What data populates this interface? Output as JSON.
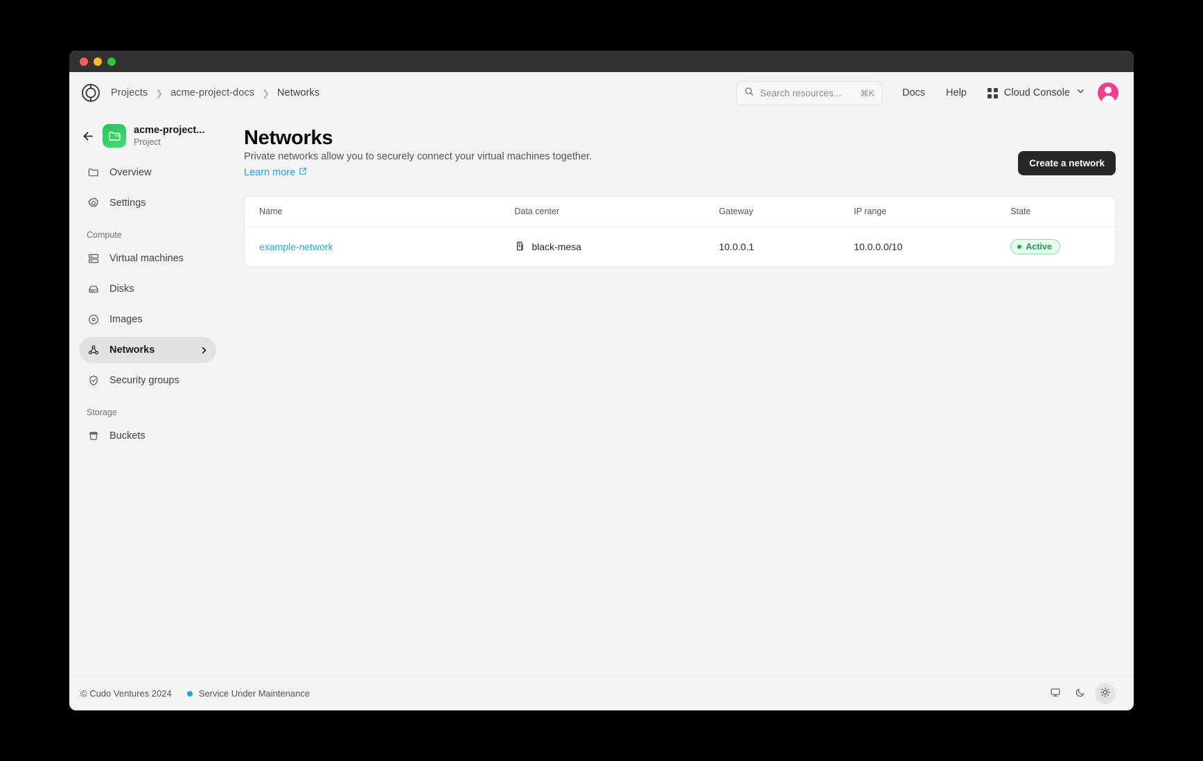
{
  "window": {
    "traffic_lights": [
      "close",
      "minimize",
      "maximize"
    ]
  },
  "topbar": {
    "logo": "cudo-logo",
    "breadcrumb": [
      {
        "label": "Projects"
      },
      {
        "label": "acme-project-docs"
      },
      {
        "label": "Networks"
      }
    ],
    "search": {
      "placeholder": "Search resources...",
      "value": "",
      "shortcut": "⌘K",
      "icon": "search-icon"
    },
    "docs_label": "Docs",
    "help_label": "Help",
    "console_label": "Cloud Console",
    "console_icon": "grid-icon",
    "console_chevron": "chevron-down-icon",
    "avatar": "user-avatar"
  },
  "sidebar": {
    "back_icon": "arrow-left-icon",
    "project": {
      "icon": "folder-icon",
      "icon_color": "#33cf65",
      "name": "acme-project...",
      "subtitle": "Project"
    },
    "items": [
      {
        "label": "Overview",
        "icon": "folder-icon",
        "active": false
      },
      {
        "label": "Settings",
        "icon": "gear-icon",
        "active": false
      }
    ],
    "groups": [
      {
        "label": "Compute",
        "items": [
          {
            "label": "Virtual machines",
            "icon": "server-icon",
            "active": false
          },
          {
            "label": "Disks",
            "icon": "disk-icon",
            "active": false
          },
          {
            "label": "Images",
            "icon": "disc-icon",
            "active": false
          },
          {
            "label": "Networks",
            "icon": "network-icon",
            "active": true,
            "chevron": "chevron-right-icon"
          },
          {
            "label": "Security groups",
            "icon": "shield-check-icon",
            "active": false
          }
        ]
      },
      {
        "label": "Storage",
        "items": [
          {
            "label": "Buckets",
            "icon": "bucket-icon",
            "active": false
          }
        ]
      }
    ]
  },
  "main": {
    "title": "Networks",
    "description": "Private networks allow you to securely connect your virtual machines together.",
    "learn_more_label": "Learn more",
    "learn_more_icon": "external-link-icon",
    "create_button_label": "Create a network",
    "table": {
      "columns": [
        "Name",
        "Data center",
        "Gateway",
        "IP range",
        "State"
      ],
      "rows": [
        {
          "name": "example-network",
          "data_center": "black-mesa",
          "data_center_icon": "building-icon",
          "gateway": "10.0.0.1",
          "ip_range": "10.0.0.0/10",
          "state": "Active",
          "state_color": "#1a9e4b"
        }
      ]
    }
  },
  "footer": {
    "copyright": "© Cudo Ventures 2024",
    "status_text": "Service Under Maintenance",
    "status_color": "#18a8f0",
    "themes": [
      {
        "icon": "monitor-icon",
        "selected": false
      },
      {
        "icon": "moon-icon",
        "selected": false
      },
      {
        "icon": "sun-icon",
        "selected": true
      }
    ]
  }
}
